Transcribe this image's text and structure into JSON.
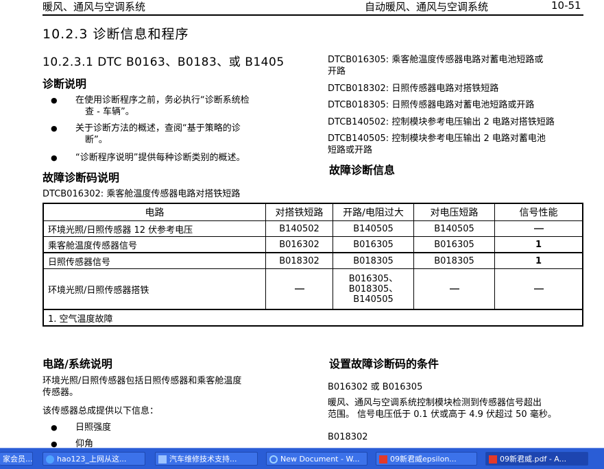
{
  "header": {
    "left": "暖风、通风与空调系统",
    "right": "自动暖风、通风与空调系统",
    "page": "10-51"
  },
  "section_title": "10.2.3 诊断信息和程序",
  "subsection_title": "10.2.3.1 DTC B0163、B0183、或 B1405",
  "diag_desc": {
    "heading": "诊断说明",
    "bullets": [
      [
        "在使用诊断程序之前，务必执行“诊断系统检",
        "查 - 车辆”。"
      ],
      [
        "关于诊断方法的概述，查阅“基于策略的诊",
        "断”。"
      ],
      [
        "“诊断程序说明”提供每种诊断类别的概述。"
      ]
    ]
  },
  "dtc_desc_heading": "故障诊断码说明",
  "dtc_first": "DTCB016302: 乘客舱温度传感器电路对搭铁短路",
  "dtc_right": [
    [
      "DTCB016305: 乘客舱温度传感器电路对蓄电池短路或",
      "开路"
    ],
    [
      "DTCB018302: 日照传感器电路对搭铁短路"
    ],
    [
      "DTCB018305: 日照传感器电路对蓄电池短路或开路"
    ],
    [
      "DTCB140502: 控制模块参考电压输出 2 电路对搭铁短路"
    ],
    [
      "DTCB140505: 控制模块参考电压输出 2 电路对蓄电池",
      "短路或开路"
    ]
  ],
  "dtc_info_heading": "故障诊断信息",
  "table": {
    "headers": [
      "电路",
      "对搭铁短路",
      "开路/电阻过大",
      "对电压短路",
      "信号性能"
    ],
    "rows": [
      [
        "环境光照/日照传感器 12 伏参考电压",
        "B140502",
        "B140505",
        "B140505",
        "—"
      ],
      [
        "乘客舱温度传感器信号",
        "B016302",
        "B016305",
        "B016305",
        "1"
      ],
      [
        "日照传感器信号",
        "B018302",
        "B018305",
        "B018305",
        "1"
      ],
      [
        "环境光照/日照传感器搭铁",
        "—",
        "B016305、\nB018305、\nB140505",
        "—",
        "—"
      ]
    ],
    "footnote": "1. 空气温度故障"
  },
  "circuit": {
    "heading": "电路/系统说明",
    "p1": [
      "环境光照/日照传感器包括日照传感器和乘客舱温度",
      "传感器。"
    ],
    "p2": "该传感器总成提供以下信息：",
    "bullets": [
      "日照强度",
      "仰角"
    ]
  },
  "conditions": {
    "heading": "设置故障诊断码的条件",
    "code1": "B016302 或 B016305",
    "text1": [
      "暖风、通风与空调系统控制模块检测到传感器信号超出",
      "范围。 信号电压低于 0.1 伏或高于 4.9 伏超过 50 毫秒。"
    ],
    "code2": "B018302"
  },
  "taskbar": {
    "items": [
      "家会员...",
      "hao123_上网从这...",
      "汽车维修技术支持...",
      "New Document - W...",
      "09新君威epsilon...",
      "09新君威.pdf - A..."
    ],
    "colors": {
      "bar": "#2a5dd6",
      "button": "#3c72ea",
      "active": "#1d45b0"
    }
  }
}
